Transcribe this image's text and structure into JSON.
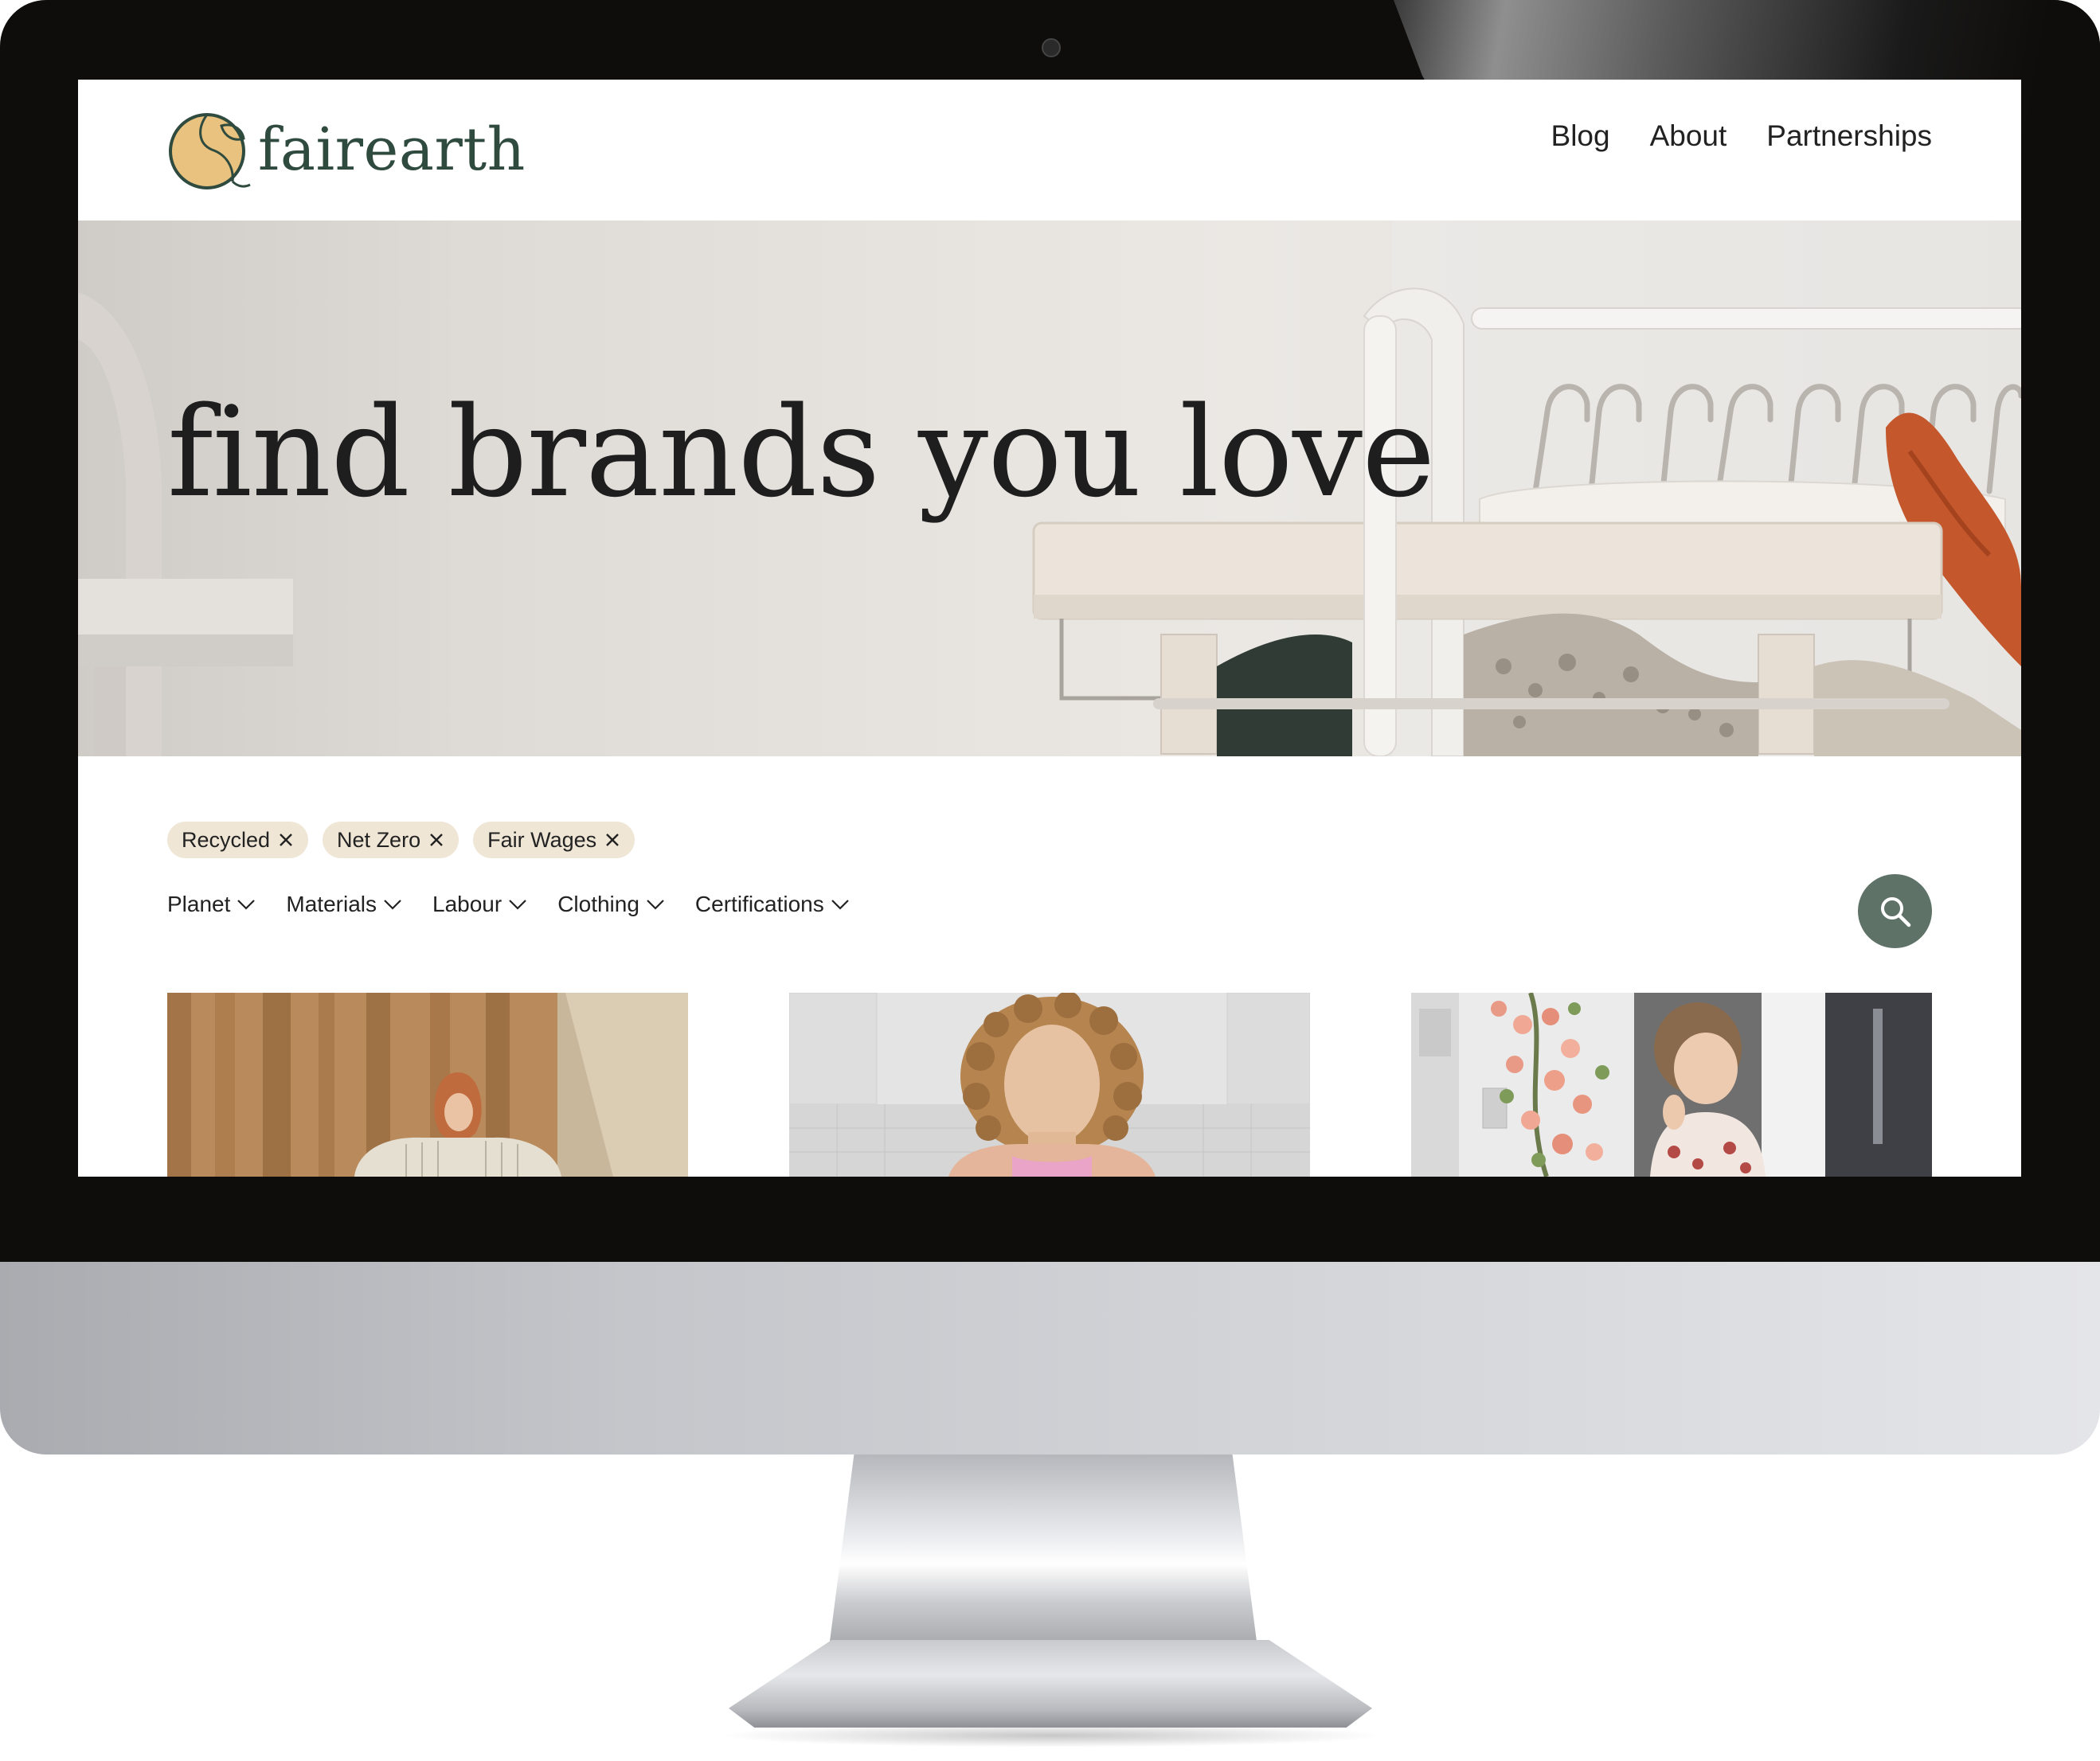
{
  "brand": {
    "name": "fairearth",
    "colors": {
      "primary": "#2f4a3e",
      "accent": "#e8c27e",
      "chip_bg": "#f0e6d6",
      "search_bg": "#5f7268"
    }
  },
  "nav": {
    "items": [
      {
        "label": "Blog"
      },
      {
        "label": "About"
      },
      {
        "label": "Partnerships"
      }
    ]
  },
  "hero": {
    "title": "find brands you love"
  },
  "active_filters": [
    {
      "label": "Recycled",
      "icon": "close-icon"
    },
    {
      "label": "Net Zero",
      "icon": "close-icon"
    },
    {
      "label": "Fair Wages",
      "icon": "close-icon"
    }
  ],
  "filter_menus": [
    {
      "label": "Planet",
      "icon": "chevron-down-icon"
    },
    {
      "label": "Materials",
      "icon": "chevron-down-icon"
    },
    {
      "label": "Labour",
      "icon": "chevron-down-icon"
    },
    {
      "label": "Clothing",
      "icon": "chevron-down-icon"
    },
    {
      "label": "Certifications",
      "icon": "chevron-down-icon"
    }
  ],
  "search": {
    "icon": "search-icon"
  },
  "cards": [
    {
      "image": "woman-curtain-photo"
    },
    {
      "image": "curly-hair-woman-photo"
    },
    {
      "image": "child-flowers-photo"
    }
  ]
}
